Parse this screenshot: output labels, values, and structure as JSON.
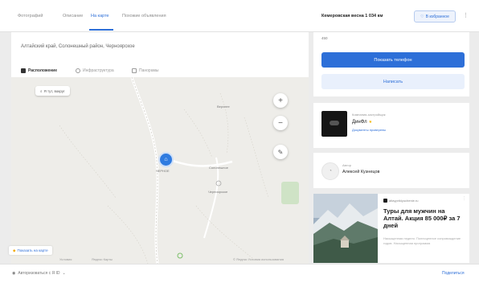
{
  "header": {
    "tabs": [
      {
        "label": "Фотографий",
        "active": false
      },
      {
        "label": "Описание",
        "active": false
      },
      {
        "label": "На карте",
        "active": true
      },
      {
        "label": "Похожие объявления",
        "active": false
      }
    ],
    "route_info": "Кемеровская весна 1 034 км",
    "save_label": "В избранное",
    "more_icon": "dots-vertical-icon"
  },
  "listing": {
    "address": "Алтайский край, Солонешный район, Черноярское",
    "map_tabs": [
      {
        "label": "Расположение",
        "icon": "map-icon",
        "active": true
      },
      {
        "label": "Инфраструктура",
        "icon": "pin-icon",
        "active": false
      },
      {
        "label": "Панорамы",
        "icon": "panorama-icon",
        "active": false
      }
    ]
  },
  "map": {
    "chip": "Я тут, вокруг",
    "zoom_in": "+",
    "zoom_out": "−",
    "pin_label": "ЧЕРНОЕ",
    "labels": [
      "Солонешное",
      "Черноярское",
      "Верхнее"
    ],
    "footer_left": "Условия",
    "footer_mid": "Яндекс Карты",
    "footer_right": "© Яндекс Условия использования",
    "info_pill": "Показать на карте"
  },
  "bottom": {
    "left_text": "Авторизоваться с Я ID",
    "right_text": "Поделиться"
  },
  "contact": {
    "price_note": "450",
    "primary_button": "Показать телефон",
    "secondary_button": "Написать"
  },
  "seller": {
    "kicker": "Компания-застройщик",
    "name": "ДинФл",
    "rating_icon": "star-icon",
    "meta": "Документы проверены"
  },
  "owner": {
    "kicker": "Автор",
    "name": "Алексей Кузнецов",
    "avatar_icon": "user-avatar-icon"
  },
  "ad": {
    "source": "altaypriklyuchenie.ru",
    "title": "Туры для мужчин на Алтай. Акция 85 000₽ за 7 дней",
    "description": "Насыщенная неделя. Полноценное сопровождение гидов. Насыщенная программа"
  },
  "colors": {
    "accent": "#2d6fd8",
    "accent_light": "#e9f0fc",
    "map_bg": "#eeede9",
    "pin": "#2f7be0"
  }
}
